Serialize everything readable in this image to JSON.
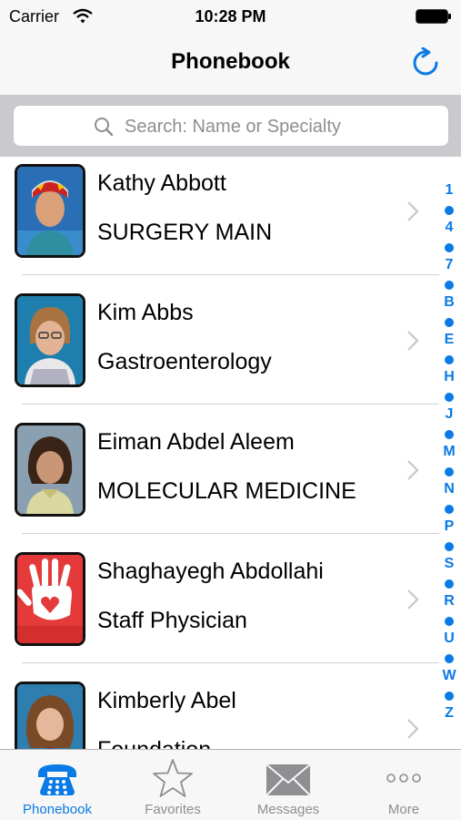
{
  "status_bar": {
    "carrier": "Carrier",
    "time": "10:28 PM"
  },
  "nav_bar": {
    "title": "Phonebook"
  },
  "search": {
    "placeholder": "Search: Name or Specialty"
  },
  "contacts": [
    {
      "name": "Kathy Abbott",
      "subtitle": "SURGERY MAIN"
    },
    {
      "name": "Kim Abbs",
      "subtitle": "Gastroenterology"
    },
    {
      "name": "Eiman Abdel Aleem",
      "subtitle": "MOLECULAR MEDICINE"
    },
    {
      "name": "Shaghayegh Abdollahi",
      "subtitle": "Staff Physician"
    },
    {
      "name": "Kimberly Abel",
      "subtitle": "Foundation"
    }
  ],
  "index": [
    "1",
    "•",
    "4",
    "•",
    "7",
    "•",
    "B",
    "•",
    "E",
    "•",
    "H",
    "•",
    "J",
    "•",
    "M",
    "•",
    "N",
    "•",
    "P",
    "•",
    "S",
    "•",
    "R",
    "•",
    "U",
    "•",
    "W",
    "•",
    "Z"
  ],
  "tabs": [
    {
      "label": "Phonebook",
      "icon": "phone-icon",
      "active": true
    },
    {
      "label": "Favorites",
      "icon": "star-icon",
      "active": false
    },
    {
      "label": "Messages",
      "icon": "envelope-icon",
      "active": false
    },
    {
      "label": "More",
      "icon": "more-icon",
      "active": false
    }
  ],
  "colors": {
    "accent": "#0a7ae6",
    "inactive": "#8e8e93",
    "bar_background": "#f7f7f7",
    "search_background": "#c9c9ce"
  }
}
